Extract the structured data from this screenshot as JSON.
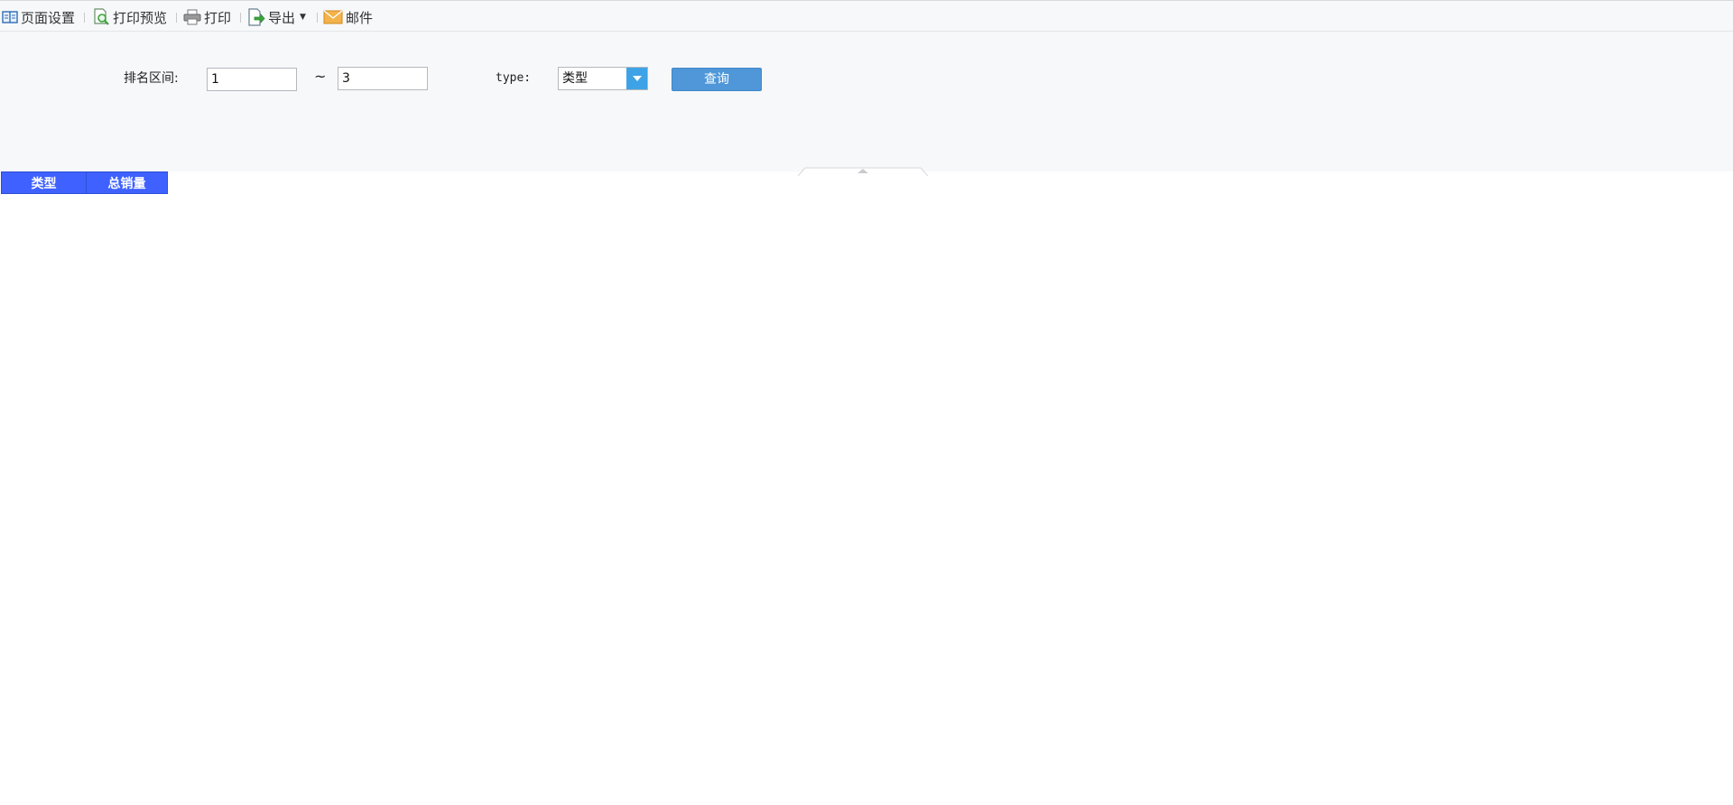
{
  "toolbar": {
    "page_setup": "页面设置",
    "print_preview": "打印预览",
    "print": "打印",
    "export": "导出",
    "mail": "邮件"
  },
  "params": {
    "rank_label": "排名区间:",
    "rank_from": "1",
    "separator": "~",
    "rank_to": "3",
    "type_label": "type:",
    "type_value": "类型",
    "query_button": "查询"
  },
  "table": {
    "columns": [
      "类型",
      "总销量"
    ]
  },
  "colors": {
    "header_bg": "#3f61ff",
    "query_btn": "#4f97d8",
    "combo_btn": "#3da3e6"
  }
}
